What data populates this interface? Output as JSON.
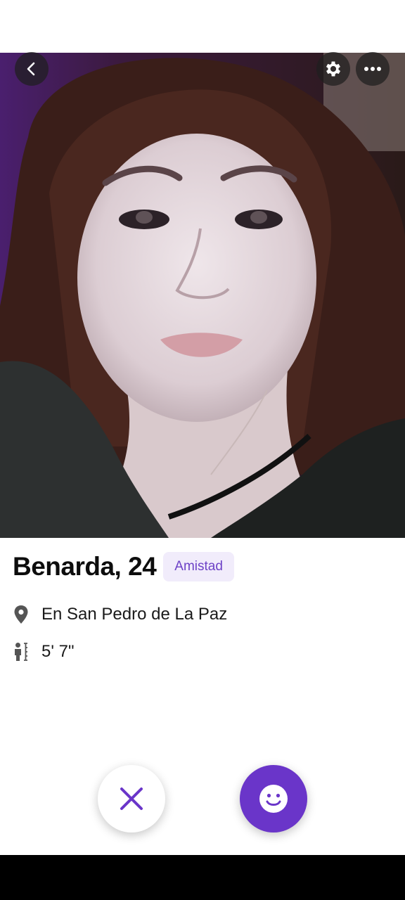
{
  "header": {
    "back_icon": "chevron-left-icon",
    "settings_icon": "gear-icon",
    "more_icon": "more-dots-icon"
  },
  "profile": {
    "name_age": "Benarda, 24",
    "tag": "Amistad",
    "location": "En San Pedro de La Paz",
    "location_icon": "location-pin-icon",
    "height": "5' 7\"",
    "height_icon": "height-icon"
  },
  "actions": {
    "dislike_icon": "close-icon",
    "like_icon": "smiley-icon"
  },
  "colors": {
    "accent": "#6a35c9",
    "tag_bg": "#f1ecfb",
    "tag_text": "#6d42c7"
  }
}
